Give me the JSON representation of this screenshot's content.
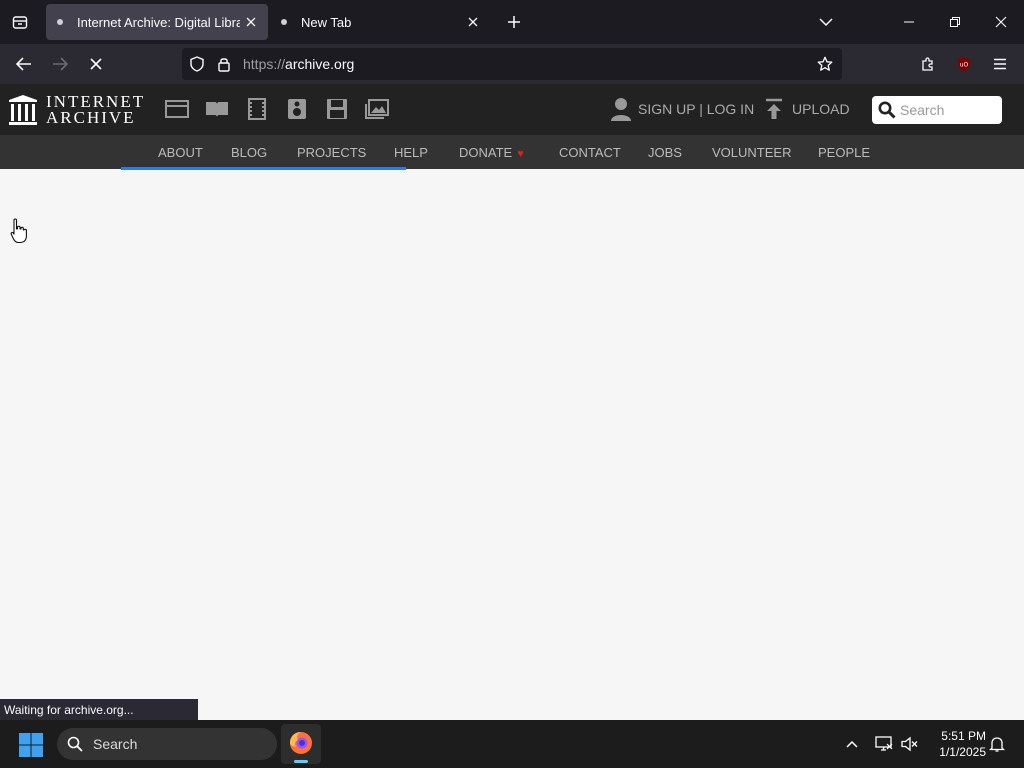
{
  "browser": {
    "tabs": [
      {
        "title": "Internet Archive: Digital Library",
        "active": true
      },
      {
        "title": "New Tab",
        "active": false
      }
    ],
    "url": {
      "protocol": "https://",
      "host": "archive.org"
    },
    "accent_color": "#2a7bf0"
  },
  "site": {
    "logo": {
      "line1": "INTERNET",
      "line2": "ARCHIVE"
    },
    "media_icons": [
      "web-icon",
      "texts-icon",
      "video-icon",
      "audio-icon",
      "software-icon",
      "images-icon"
    ],
    "account_label": "SIGN UP | LOG IN",
    "upload_label": "UPLOAD",
    "search_placeholder": "Search",
    "nav": [
      "ABOUT",
      "BLOG",
      "PROJECTS",
      "HELP",
      "DONATE",
      "CONTACT",
      "JOBS",
      "VOLUNTEER",
      "PEOPLE"
    ],
    "donate_heart_color": "#e02020"
  },
  "status": {
    "text": "Waiting for archive.org..."
  },
  "taskbar": {
    "search_label": "Search",
    "time": "5:51 PM",
    "date": "1/1/2025"
  }
}
